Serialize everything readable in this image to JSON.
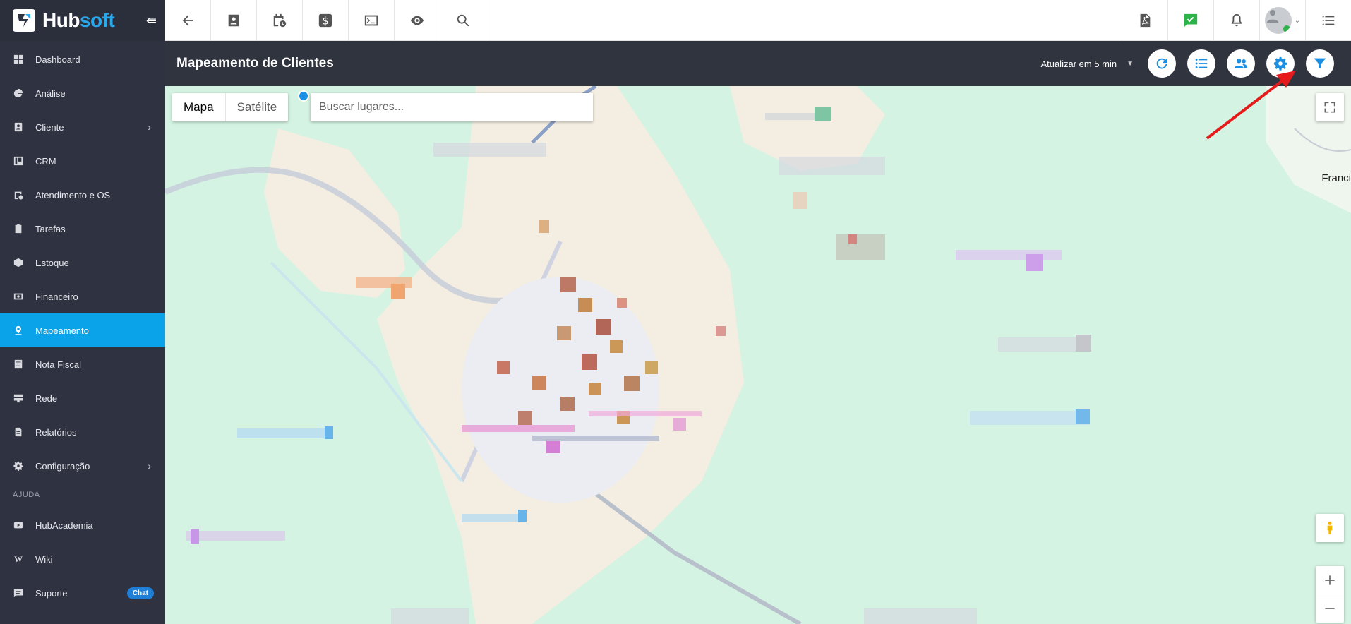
{
  "brand": {
    "name_part1": "Hub",
    "name_part2": "soft"
  },
  "sidebar": {
    "items": [
      {
        "label": "Dashboard",
        "icon": "dashboard-icon"
      },
      {
        "label": "Análise",
        "icon": "pie-chart-icon"
      },
      {
        "label": "Cliente",
        "icon": "contact-card-icon",
        "has_submenu": true
      },
      {
        "label": "CRM",
        "icon": "kanban-icon"
      },
      {
        "label": "Atendimento e OS",
        "icon": "calendar-clock-icon"
      },
      {
        "label": "Tarefas",
        "icon": "clipboard-icon"
      },
      {
        "label": "Estoque",
        "icon": "box-icon"
      },
      {
        "label": "Financeiro",
        "icon": "money-icon"
      },
      {
        "label": "Mapeamento",
        "icon": "map-pin-icon",
        "active": true
      },
      {
        "label": "Nota Fiscal",
        "icon": "receipt-icon"
      },
      {
        "label": "Rede",
        "icon": "server-icon"
      },
      {
        "label": "Relatórios",
        "icon": "report-icon"
      },
      {
        "label": "Configuração",
        "icon": "gear-icon",
        "has_submenu": true
      }
    ],
    "section_help": "AJUDA",
    "help_items": [
      {
        "label": "HubAcademia",
        "icon": "video-icon"
      },
      {
        "label": "Wiki",
        "icon": "wiki-icon"
      },
      {
        "label": "Suporte",
        "icon": "chat-icon",
        "badge": "Chat"
      }
    ]
  },
  "header": {
    "title": "Mapeamento de Clientes",
    "refresh_label": "Atualizar em 5 min"
  },
  "map": {
    "type_map": "Mapa",
    "type_satellite": "Satélite",
    "search_placeholder": "Buscar lugares...",
    "place_label": "Franci"
  },
  "colors": {
    "sidebar_bg": "#2f3341",
    "active": "#0aa2e9",
    "accent": "#1a8fe3",
    "header_bg": "#30343f"
  }
}
